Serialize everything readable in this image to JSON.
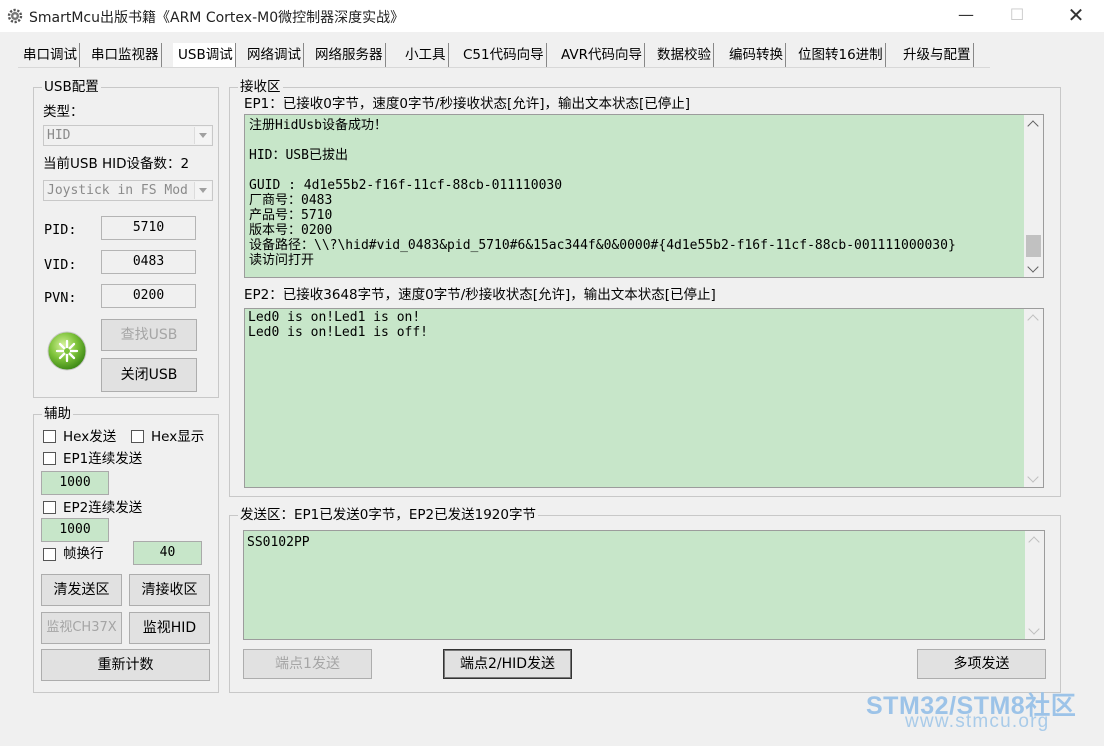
{
  "window": {
    "title": "SmartMcu出版书籍《ARM Cortex-M0微控制器深度实战》",
    "icon": "gear-icon",
    "minimize_glyph": "—",
    "maximize_glyph": "☐",
    "close_glyph": "✕"
  },
  "tabs": [
    {
      "label": "串口调试"
    },
    {
      "label": "串口监视器"
    },
    {
      "label": "USB调试",
      "active": true
    },
    {
      "label": "网络调试"
    },
    {
      "label": "网络服务器"
    },
    {
      "label": "小工具"
    },
    {
      "label": "C51代码向导"
    },
    {
      "label": "AVR代码向导"
    },
    {
      "label": "数据校验"
    },
    {
      "label": "编码转换"
    },
    {
      "label": "位图转16进制"
    },
    {
      "label": "升级与配置"
    }
  ],
  "usb_config": {
    "legend": "USB配置",
    "type_label": "类型：",
    "type_value": "HID",
    "device_count_label": "当前USB HID设备数：2",
    "device_value": "Joystick in FS Mod",
    "pid_label": "PID:",
    "pid_value": "5710",
    "vid_label": "VID:",
    "vid_value": "0483",
    "pvn_label": "PVN:",
    "pvn_value": "0200",
    "find_button": "查找USB",
    "close_button": "关闭USB",
    "status_icon": "usb-connected-icon",
    "status_color": "#7dc23a"
  },
  "aux": {
    "legend": "辅助",
    "hex_send": "Hex发送",
    "hex_show": "Hex显示",
    "ep1_continuous": "EP1连续发送",
    "ep1_interval": "1000",
    "ep2_continuous": "EP2连续发送",
    "ep2_interval": "1000",
    "frame_newline": "帧换行",
    "frame_value": "40",
    "clear_send": "清发送区",
    "clear_recv": "清接收区",
    "monitor_ch37x": "监视CH37X",
    "monitor_hid": "监视HID",
    "reset_count": "重新计数"
  },
  "receive": {
    "legend": "接收区",
    "ep1_status": "EP1：已接收0字节，速度0字节/秒接收状态[允许]，输出文本状态[已停止]",
    "ep1_text": "注册HidUsb设备成功！\n\nHID：USB已拔出\n\nGUID : 4d1e55b2-f16f-11cf-88cb-011110030\n厂商号：0483\n产品号：5710\n版本号：0200\n设备路径：\\\\?\\hid#vid_0483&pid_5710#6&15ac344f&0&0000#{4d1e55b2-f16f-11cf-88cb-001111000030}\n读访问打开",
    "ep2_status": "EP2：已接收3648字节，速度0字节/秒接收状态[允许]，输出文本状态[已停止]",
    "ep2_text": "Led0 is on!Led1 is on!\nLed0 is on!Led1 is off!"
  },
  "send": {
    "legend": "发送区：EP1已发送0字节，EP2已发送1920字节",
    "text": "SS0102PP",
    "ep1_send": "端点1发送",
    "ep2_send": "端点2/HID发送",
    "multi_send": "多项发送"
  },
  "watermark": {
    "line1": "STM32/STM8社区",
    "line2": "www.stmcu.org"
  },
  "colors": {
    "text_area_bg": "#c7e6c9",
    "window_bg": "#f0f0f0",
    "watermark": "#9cc3e8"
  }
}
